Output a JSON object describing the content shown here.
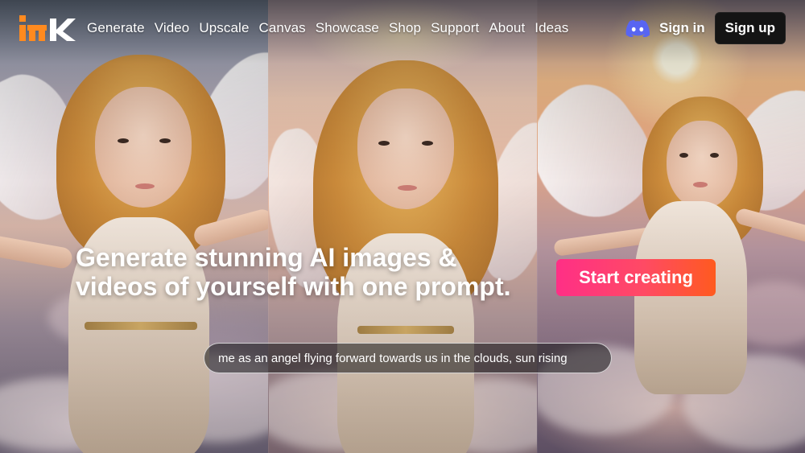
{
  "brand": {
    "logo_text": "mk"
  },
  "nav": {
    "items": [
      {
        "label": "Generate"
      },
      {
        "label": "Video"
      },
      {
        "label": "Upscale"
      },
      {
        "label": "Canvas"
      },
      {
        "label": "Showcase"
      },
      {
        "label": "Shop"
      },
      {
        "label": "Support"
      },
      {
        "label": "About"
      },
      {
        "label": "Ideas"
      }
    ]
  },
  "auth": {
    "sign_in": "Sign in",
    "sign_up": "Sign up"
  },
  "hero": {
    "headline_line1": "Generate stunning AI images &",
    "headline_line2": "videos of yourself with one prompt.",
    "cta": "Start creating",
    "prompt_text": "me as an angel flying forward towards us in the clouds, sun rising"
  },
  "colors": {
    "logo": "#ff8a1f",
    "discord": "#5865f2",
    "signup_bg": "#141414",
    "cta_start": "#ff2f86",
    "cta_end": "#ff5a1f"
  },
  "icons": {
    "discord": "discord-icon",
    "logo": "brand-logo"
  }
}
